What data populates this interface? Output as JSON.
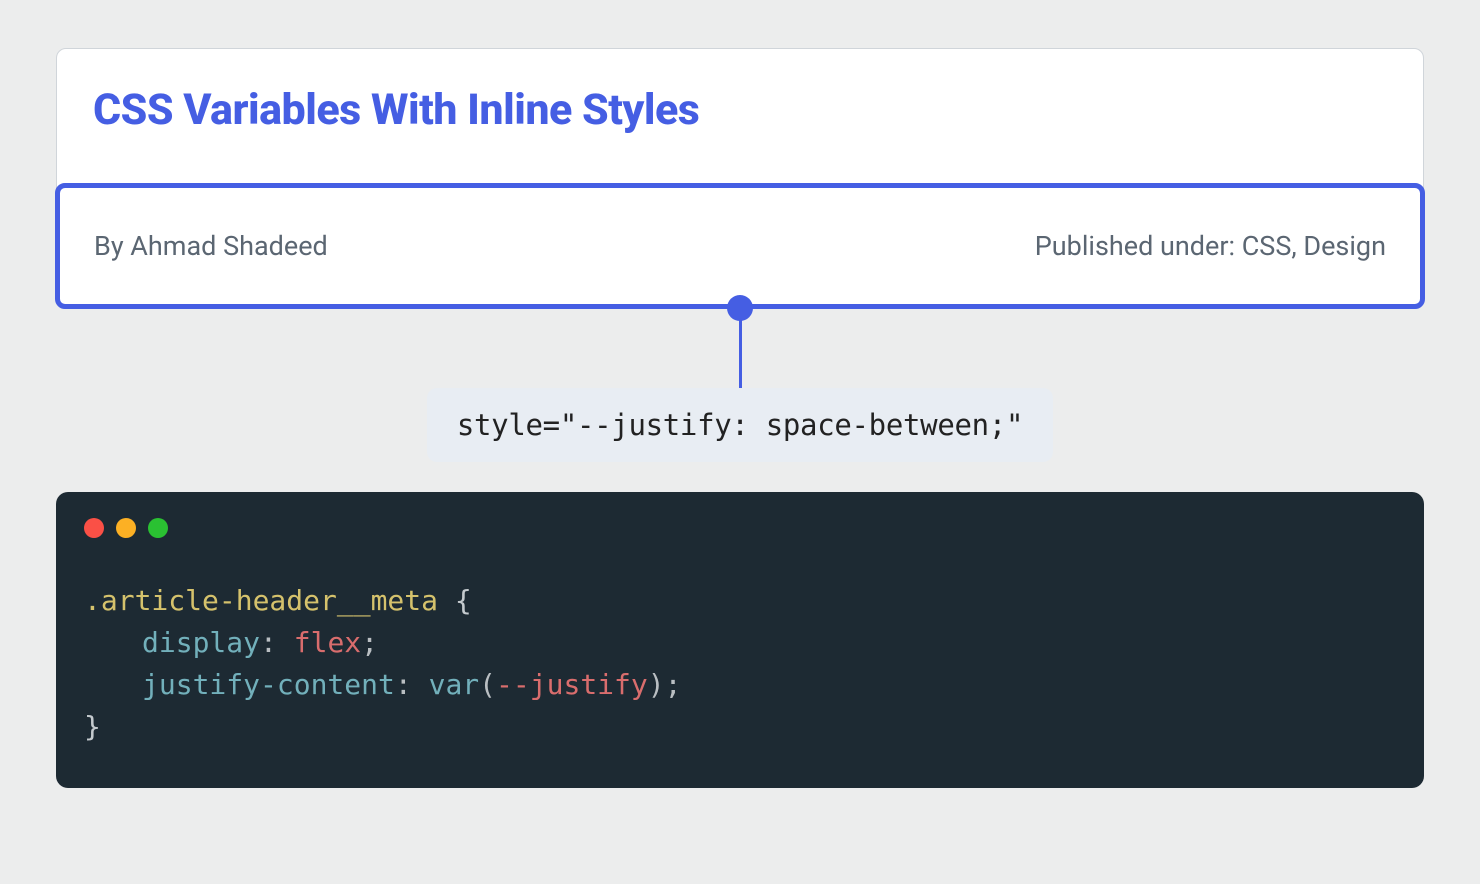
{
  "article": {
    "title": "CSS Variables With Inline Styles",
    "byline": "By Ahmad Shadeed",
    "published": "Published under: CSS, Design"
  },
  "annotation": {
    "style_attr": "style=\"--justify: space-between;\""
  },
  "code": {
    "selector": ".article-header__meta",
    "open_brace": " {",
    "line1_prop": "display",
    "line1_colon": ": ",
    "line1_value": "flex",
    "line1_semicolon": ";",
    "line2_prop": "justify-content",
    "line2_colon": ": ",
    "line2_func": "var",
    "line2_open": "(",
    "line2_varname": "--justify",
    "line2_close": ")",
    "line2_semicolon": ";",
    "close_brace": "}"
  }
}
